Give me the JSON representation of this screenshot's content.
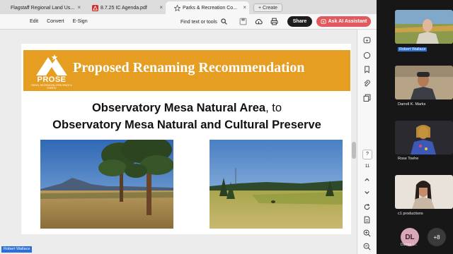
{
  "tabs": [
    {
      "label": "Flagstaff Regional Land Us...",
      "icon": "acrobat-icon"
    },
    {
      "label": "8.7.25 IC Agenda.pdf",
      "icon": "pdf-icon"
    },
    {
      "label": "Parks & Recreation Co...",
      "icon": "star-icon"
    }
  ],
  "create_label": "+ Create",
  "menu": [
    "Edit",
    "Convert",
    "E-Sign"
  ],
  "find_label": "Find text or tools",
  "share_label": "Share",
  "ai_label": "Ask AI Assistant",
  "slide": {
    "logo_text": "PROSE",
    "logo_sub": "PARKS, RECREATION OPEN SPACE & EVENTS",
    "banner_title": "Proposed Renaming Recommendation",
    "line1_bold": "Observatory Mesa Natural Area",
    "line1_rest": ", to",
    "line2": "Observatory Mesa Natural and Cultural Preserve"
  },
  "page_box": "?",
  "page_num": "11",
  "presenter_tag": "Robert Wallace",
  "participants": [
    {
      "name": "Robert Wallace",
      "highlight": true
    },
    {
      "name": "Darrell K. Marks",
      "highlight": false
    },
    {
      "name": "Rose Toehe",
      "highlight": false
    },
    {
      "name": "c1 productions",
      "highlight": false
    }
  ],
  "bottom_avatar": {
    "initials": "DL",
    "name": "Darren L..."
  },
  "more_count": "+8",
  "colors": {
    "banner": "#e59d22",
    "ai_button": "#e2585c",
    "presenter_tag": "#2b6fd6"
  }
}
